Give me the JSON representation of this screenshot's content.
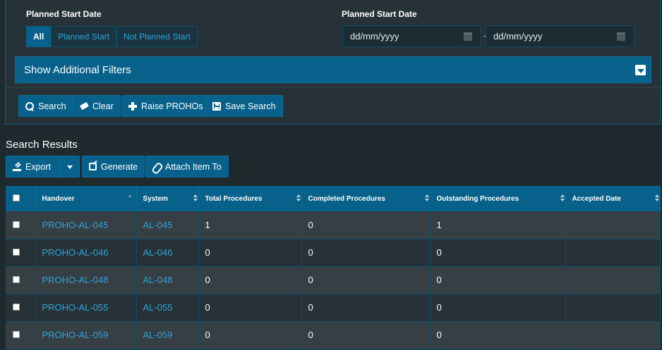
{
  "filters": {
    "planned_start_label_left": "Planned Start Date",
    "planned_start_label_right": "Planned Start Date",
    "segment_options": [
      "All",
      "Planned Start",
      "Not Planned Start"
    ],
    "date_from_placeholder": "dd/mm/yyyy",
    "date_to_placeholder": "dd/mm/yyyy",
    "date_separator": "-",
    "additional_filters_label": "Show Additional Filters"
  },
  "actions": {
    "search": "Search",
    "clear": "Clear",
    "raise": "Raise PROHOs",
    "save_search": "Save Search"
  },
  "results": {
    "title": "Search Results",
    "export": "Export",
    "generate": "Generate",
    "attach": "Attach Item To",
    "columns": [
      "Handover",
      "System",
      "Total Procedures",
      "Completed Procedures",
      "Outstanding Procedures",
      "Accepted Date"
    ],
    "rows": [
      {
        "handover": "PROHO-AL-045",
        "system": "AL-045",
        "total": "1",
        "completed": "0",
        "outstanding": "1",
        "accepted": ""
      },
      {
        "handover": "PROHO-AL-046",
        "system": "AL-046",
        "total": "0",
        "completed": "0",
        "outstanding": "0",
        "accepted": ""
      },
      {
        "handover": "PROHO-AL-048",
        "system": "AL-048",
        "total": "0",
        "completed": "0",
        "outstanding": "0",
        "accepted": ""
      },
      {
        "handover": "PROHO-AL-055",
        "system": "AL-055",
        "total": "0",
        "completed": "0",
        "outstanding": "0",
        "accepted": ""
      },
      {
        "handover": "PROHO-AL-059",
        "system": "AL-059",
        "total": "0",
        "completed": "0",
        "outstanding": "0",
        "accepted": ""
      }
    ]
  },
  "colors": {
    "accent": "#07618a",
    "link": "#2fa3d8",
    "background": "#1f2a2f",
    "panel": "#263238"
  }
}
